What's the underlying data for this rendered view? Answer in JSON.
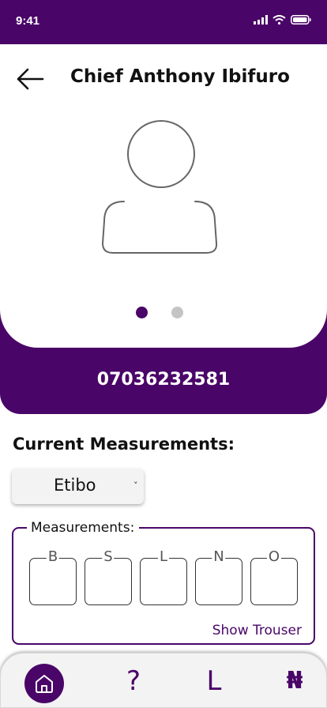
{
  "status_bar": {
    "time": "9:41"
  },
  "header": {
    "title": "Chief Anthony Ibifuro"
  },
  "carousel": {
    "page_count": 2,
    "active_index": 0
  },
  "contact": {
    "phone": "07036232581"
  },
  "current_measurements": {
    "heading": "Current Measurements:",
    "style_select": {
      "value": "Etibo",
      "chevron": "˅"
    }
  },
  "measurements": {
    "legend": "Measurements:",
    "fields": [
      {
        "label": "B",
        "value": ""
      },
      {
        "label": "S",
        "value": ""
      },
      {
        "label": "L",
        "value": ""
      },
      {
        "label": "N",
        "value": ""
      },
      {
        "label": "O",
        "value": ""
      }
    ],
    "toggle_label": "Show Trouser"
  },
  "tab_bar": {
    "items": [
      {
        "name": "home",
        "icon": "home-icon",
        "label": ""
      },
      {
        "name": "help",
        "icon": "question-icon",
        "label": "?"
      },
      {
        "name": "l",
        "icon": "letter-l-icon",
        "label": "L"
      },
      {
        "name": "payments",
        "icon": "naira-icon",
        "label": "₦"
      }
    ]
  },
  "colors": {
    "brand": "#4a0568",
    "dot_inactive": "#c4c4c4",
    "select_bg": "#f3f3f3"
  }
}
